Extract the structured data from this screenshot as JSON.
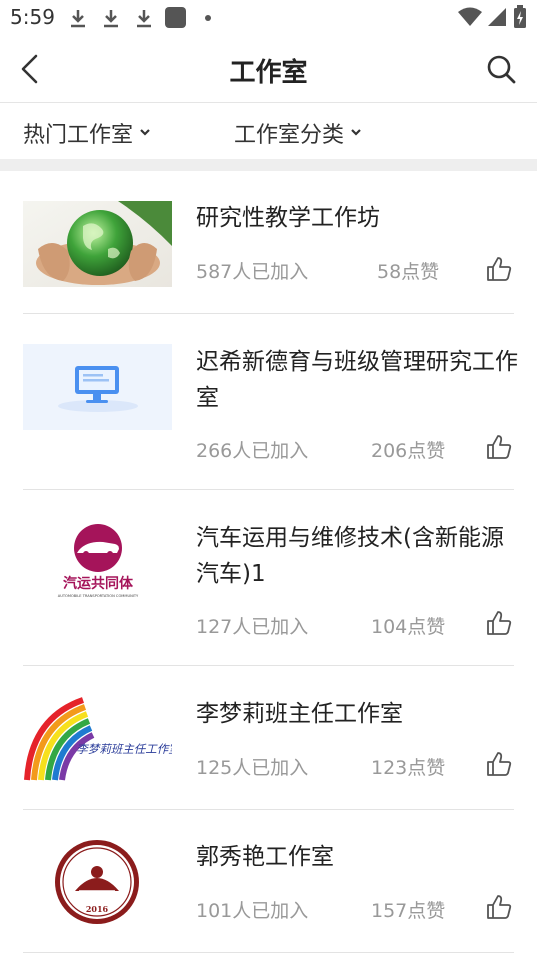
{
  "status_bar": {
    "time": "5:59"
  },
  "header": {
    "title": "工作室"
  },
  "filters": [
    {
      "label": "热门工作室"
    },
    {
      "label": "工作室分类"
    }
  ],
  "studios": [
    {
      "title": "研究性教学工作坊",
      "joined": "587人已加入",
      "likes": "58点赞",
      "thumb": "globe-in-hands-image"
    },
    {
      "title": "迟希新德育与班级管理研究工作室",
      "joined": "266人已加入",
      "likes": "206点赞",
      "thumb": "computer-monitor-image"
    },
    {
      "title": "汽车运用与维修技术(含新能源汽车)1",
      "joined": "127人已加入",
      "likes": "104点赞",
      "thumb": "auto-community-logo",
      "logo_text": "汽运共同体",
      "logo_subtext": "AUTOMOBILE TRANSPORTATION COMMUNITY"
    },
    {
      "title": "李梦莉班主任工作室",
      "joined": "125人已加入",
      "likes": "123点赞",
      "thumb": "rainbow-logo",
      "logo_text": "李梦莉班主任工作室"
    },
    {
      "title": "郭秀艳工作室",
      "joined": "101人已加入",
      "likes": "157点赞",
      "thumb": "circular-seal-logo",
      "logo_text": "2016"
    }
  ],
  "colors": {
    "accent_red": "#a5145a",
    "text_gray": "#999999"
  }
}
